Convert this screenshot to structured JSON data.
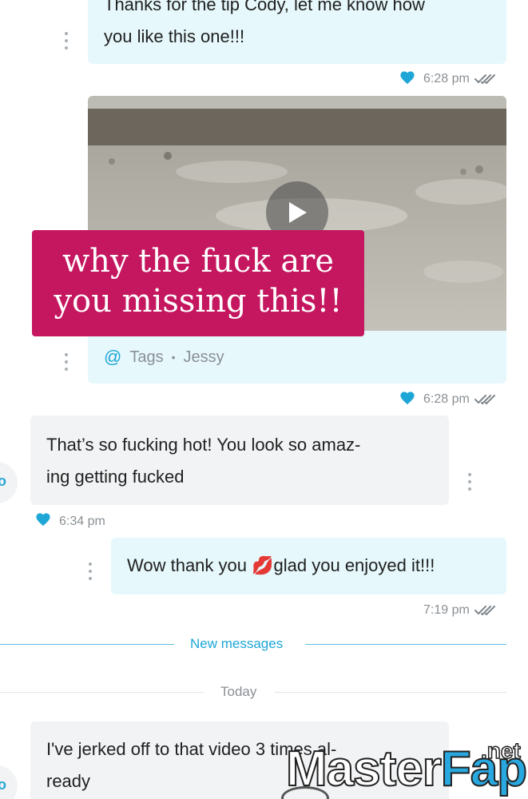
{
  "colors": {
    "outgoing_bubble": "#e6f8fc",
    "incoming_bubble": "#f1f3f4",
    "accent": "#1ea6d6",
    "promo": "#c4175f",
    "meta_text": "#8a9095"
  },
  "messages": {
    "m1": {
      "direction": "outgoing",
      "lines": [
        "Thanks for the tip Cody, let me know how",
        "you like this one!!!"
      ],
      "time": "6:28 pm",
      "liked": true,
      "read_icon": "double-check-icon"
    },
    "m2": {
      "direction": "outgoing",
      "type": "video",
      "tags_label": "Tags",
      "tag_value": "Jessy",
      "time": "6:28 pm",
      "liked": true,
      "read_icon": "double-check-icon"
    },
    "m3": {
      "direction": "incoming",
      "lines": [
        "That’s so fucking hot! You look so amaz-",
        "ing getting fucked"
      ],
      "time": "6:34 pm",
      "liked": true
    },
    "m4": {
      "direction": "outgoing",
      "text_before": "Wow thank you ",
      "emoji": "💋",
      "text_after": "glad you enjoyed it!!!",
      "time": "7:19 pm",
      "read_icon": "double-check-icon"
    },
    "m5": {
      "direction": "incoming",
      "lines": [
        "I've jerked off to that video 3 times al-",
        "ready"
      ]
    }
  },
  "promo_overlay": {
    "lines": [
      "why the fuck are",
      "you missing this!!"
    ]
  },
  "dividers": {
    "new_messages": "New messages",
    "today": "Today"
  },
  "avatar": {
    "initial": "o"
  },
  "watermark": {
    "brand_part1": "Master",
    "brand_part2": "Fap",
    "suffix": ".net"
  }
}
